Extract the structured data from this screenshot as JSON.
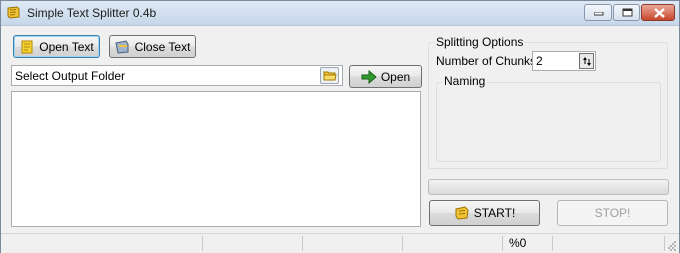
{
  "window": {
    "title": "Simple Text Splitter 0.4b"
  },
  "toolbar": {
    "open_text_label": "Open Text",
    "close_text_label": "Close Text"
  },
  "output": {
    "folder_value": "Select Output Folder",
    "open_label": "Open"
  },
  "options": {
    "group_title": "Splitting Options",
    "chunks_label": "Number of Chunks:",
    "chunks_value": "2",
    "naming_title": "Naming"
  },
  "progress": {
    "value": 0
  },
  "actions": {
    "start_label": "START!",
    "stop_label": "STOP!"
  },
  "status": {
    "panels": [
      "",
      "",
      "",
      "",
      "%0",
      ""
    ]
  },
  "colors": {
    "accent_folder": "#f1c233",
    "open_arrow": "#2e9d2e"
  },
  "icons": {
    "app": "app-icon",
    "open_text": "yellow-note-icon",
    "close_text": "close-doc-icon",
    "browse": "folder-icon",
    "open": "green-arrow-icon",
    "start": "start-icon"
  }
}
